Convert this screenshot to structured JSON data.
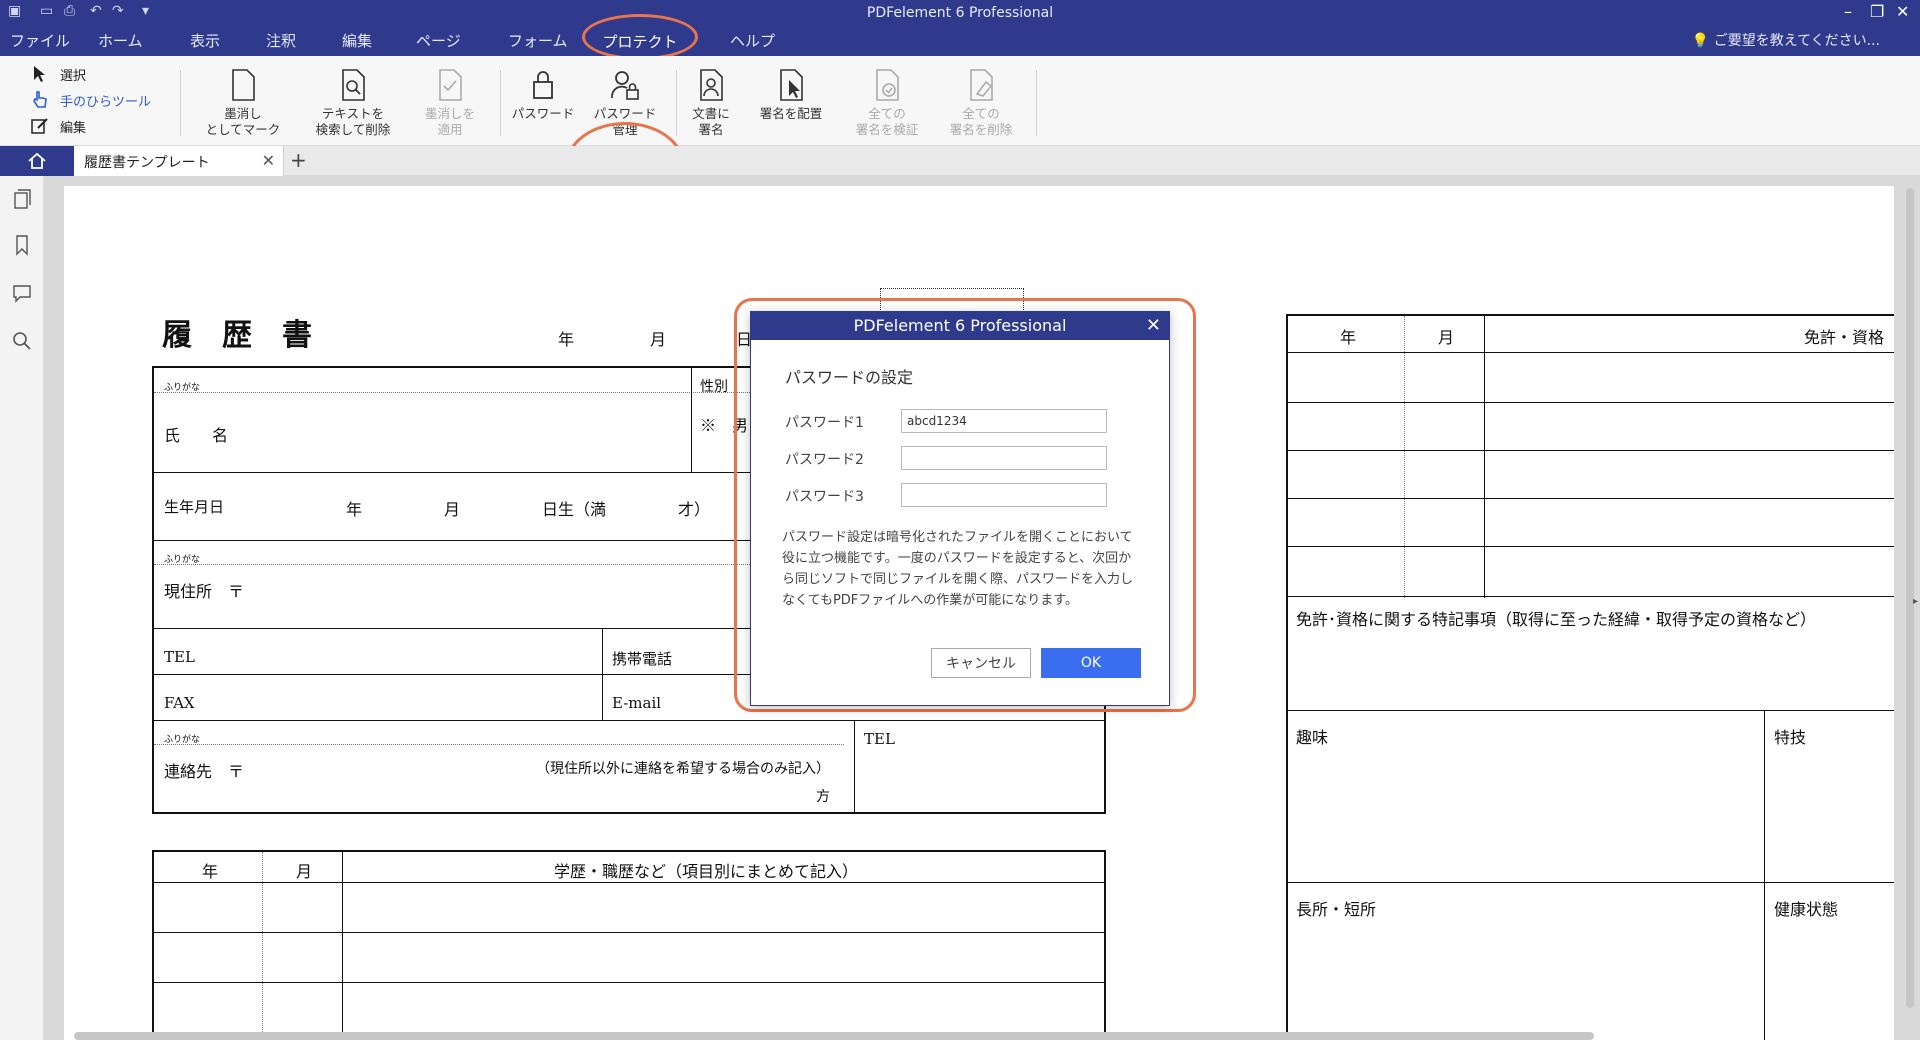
{
  "app": {
    "title": "PDFelement 6 Professional",
    "menu": [
      "ファイル",
      "ホーム",
      "表示",
      "注釈",
      "編集",
      "ページ",
      "フォーム",
      "プロテクト",
      "ヘルプ"
    ],
    "active_menu": "プロテクト",
    "hint": "ご要望を教えてください...",
    "accent": "#2f3a8c",
    "highlight": "#e8744c"
  },
  "ribbon": {
    "modes": [
      "選択",
      "手のひらツール",
      "編集"
    ],
    "buttons": {
      "redact_mark": "墨消し\nとしてマーク",
      "search_delete": "テキストを\n検索して削除",
      "apply_redact": "墨消しを\n適用",
      "password": "パスワード",
      "password_mgmt": "パスワード\n管理",
      "sign_doc": "文書に\n署名",
      "place_sig": "署名を配置",
      "verify_all": "全ての\n署名を検証",
      "delete_all": "全ての\n署名を削除"
    }
  },
  "tabs": {
    "doc": "履歴書テンプレート"
  },
  "resume": {
    "title": "履　歴　書",
    "date": [
      "年",
      "月",
      "日"
    ],
    "furigana": "ふりがな",
    "name": "氏　　名",
    "gender": "性別",
    "gender_val": "※　男",
    "birth": "生年月日",
    "birth_parts": [
      "年",
      "月",
      "日生（満",
      "才）"
    ],
    "address": "現住所　〒",
    "tel": "TEL",
    "mobile": "携帯電話",
    "fax": "FAX",
    "email": "E-mail",
    "contact": "連絡先　〒",
    "contact_note": "（現住所以外に連絡を希望する場合のみ記入）",
    "contact_kata": "方",
    "contact_tel": "TEL",
    "hist_year": "年",
    "hist_month": "月",
    "hist_header": "学歴・職歴など（項目別にまとめて記入）",
    "lic_year": "年",
    "lic_month": "月",
    "lic_header": "免許・資格",
    "lic_note": "免許･資格に関する特記事項（取得に至った経緯・取得予定の資格など）",
    "hobby": "趣味",
    "skill": "特技",
    "strength": "長所・短所",
    "health": "健康状態"
  },
  "dialog": {
    "title": "PDFelement 6 Professional",
    "heading": "パスワードの設定",
    "labels": [
      "パスワード1",
      "パスワード2",
      "パスワード3"
    ],
    "values": [
      "abcd1234",
      "",
      ""
    ],
    "description": "パスワード設定は暗号化されたファイルを開くことにおいて役に立つ機能です。一度のパスワードを設定すると、次回から同じソフトで同じファイルを開く際、パスワードを入力しなくてもPDFファイルへの作業が可能になります。",
    "cancel": "キャンセル",
    "ok": "OK"
  }
}
